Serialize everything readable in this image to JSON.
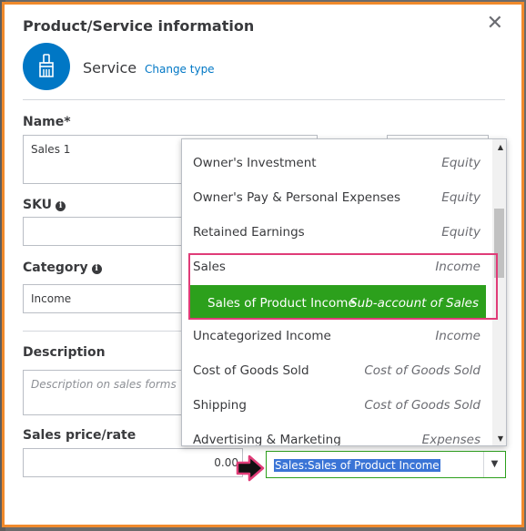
{
  "dialog": {
    "title": "Product/Service information",
    "type_label": "Service",
    "change_type": "Change type"
  },
  "form": {
    "name_label": "Name*",
    "name_value": "Sales 1",
    "sku_label": "SKU",
    "category_label": "Category",
    "category_value": "Income",
    "description_label": "Description",
    "description_placeholder": "Description on sales forms",
    "price_label": "Sales price/rate",
    "price_value": "0.00",
    "income_account_value": "Sales:Sales of Product Income"
  },
  "dropdown": {
    "items": [
      {
        "name": "Owner's Investment",
        "type": "Equity"
      },
      {
        "name": "Owner's Pay & Personal Expenses",
        "type": "Equity"
      },
      {
        "name": "Retained Earnings",
        "type": "Equity"
      },
      {
        "name": "Sales",
        "type": "Income"
      },
      {
        "name": "Sales of Product Income",
        "type": "Sub-account of Sales"
      },
      {
        "name": "Uncategorized Income",
        "type": "Income"
      },
      {
        "name": "Cost of Goods Sold",
        "type": "Cost of Goods Sold"
      },
      {
        "name": "Shipping",
        "type": "Cost of Goods Sold"
      },
      {
        "name": "Advertising & Marketing",
        "type": "Expenses"
      }
    ]
  },
  "colors": {
    "accent_green": "#2ca01c",
    "brand_blue": "#0077c5",
    "highlight_pink": "#e03c78",
    "frame_orange": "#f08a2c"
  },
  "icons": {
    "service": "paintbrush-icon",
    "close": "close-icon",
    "info": "info-icon",
    "pointer": "arrow-right-icon"
  }
}
